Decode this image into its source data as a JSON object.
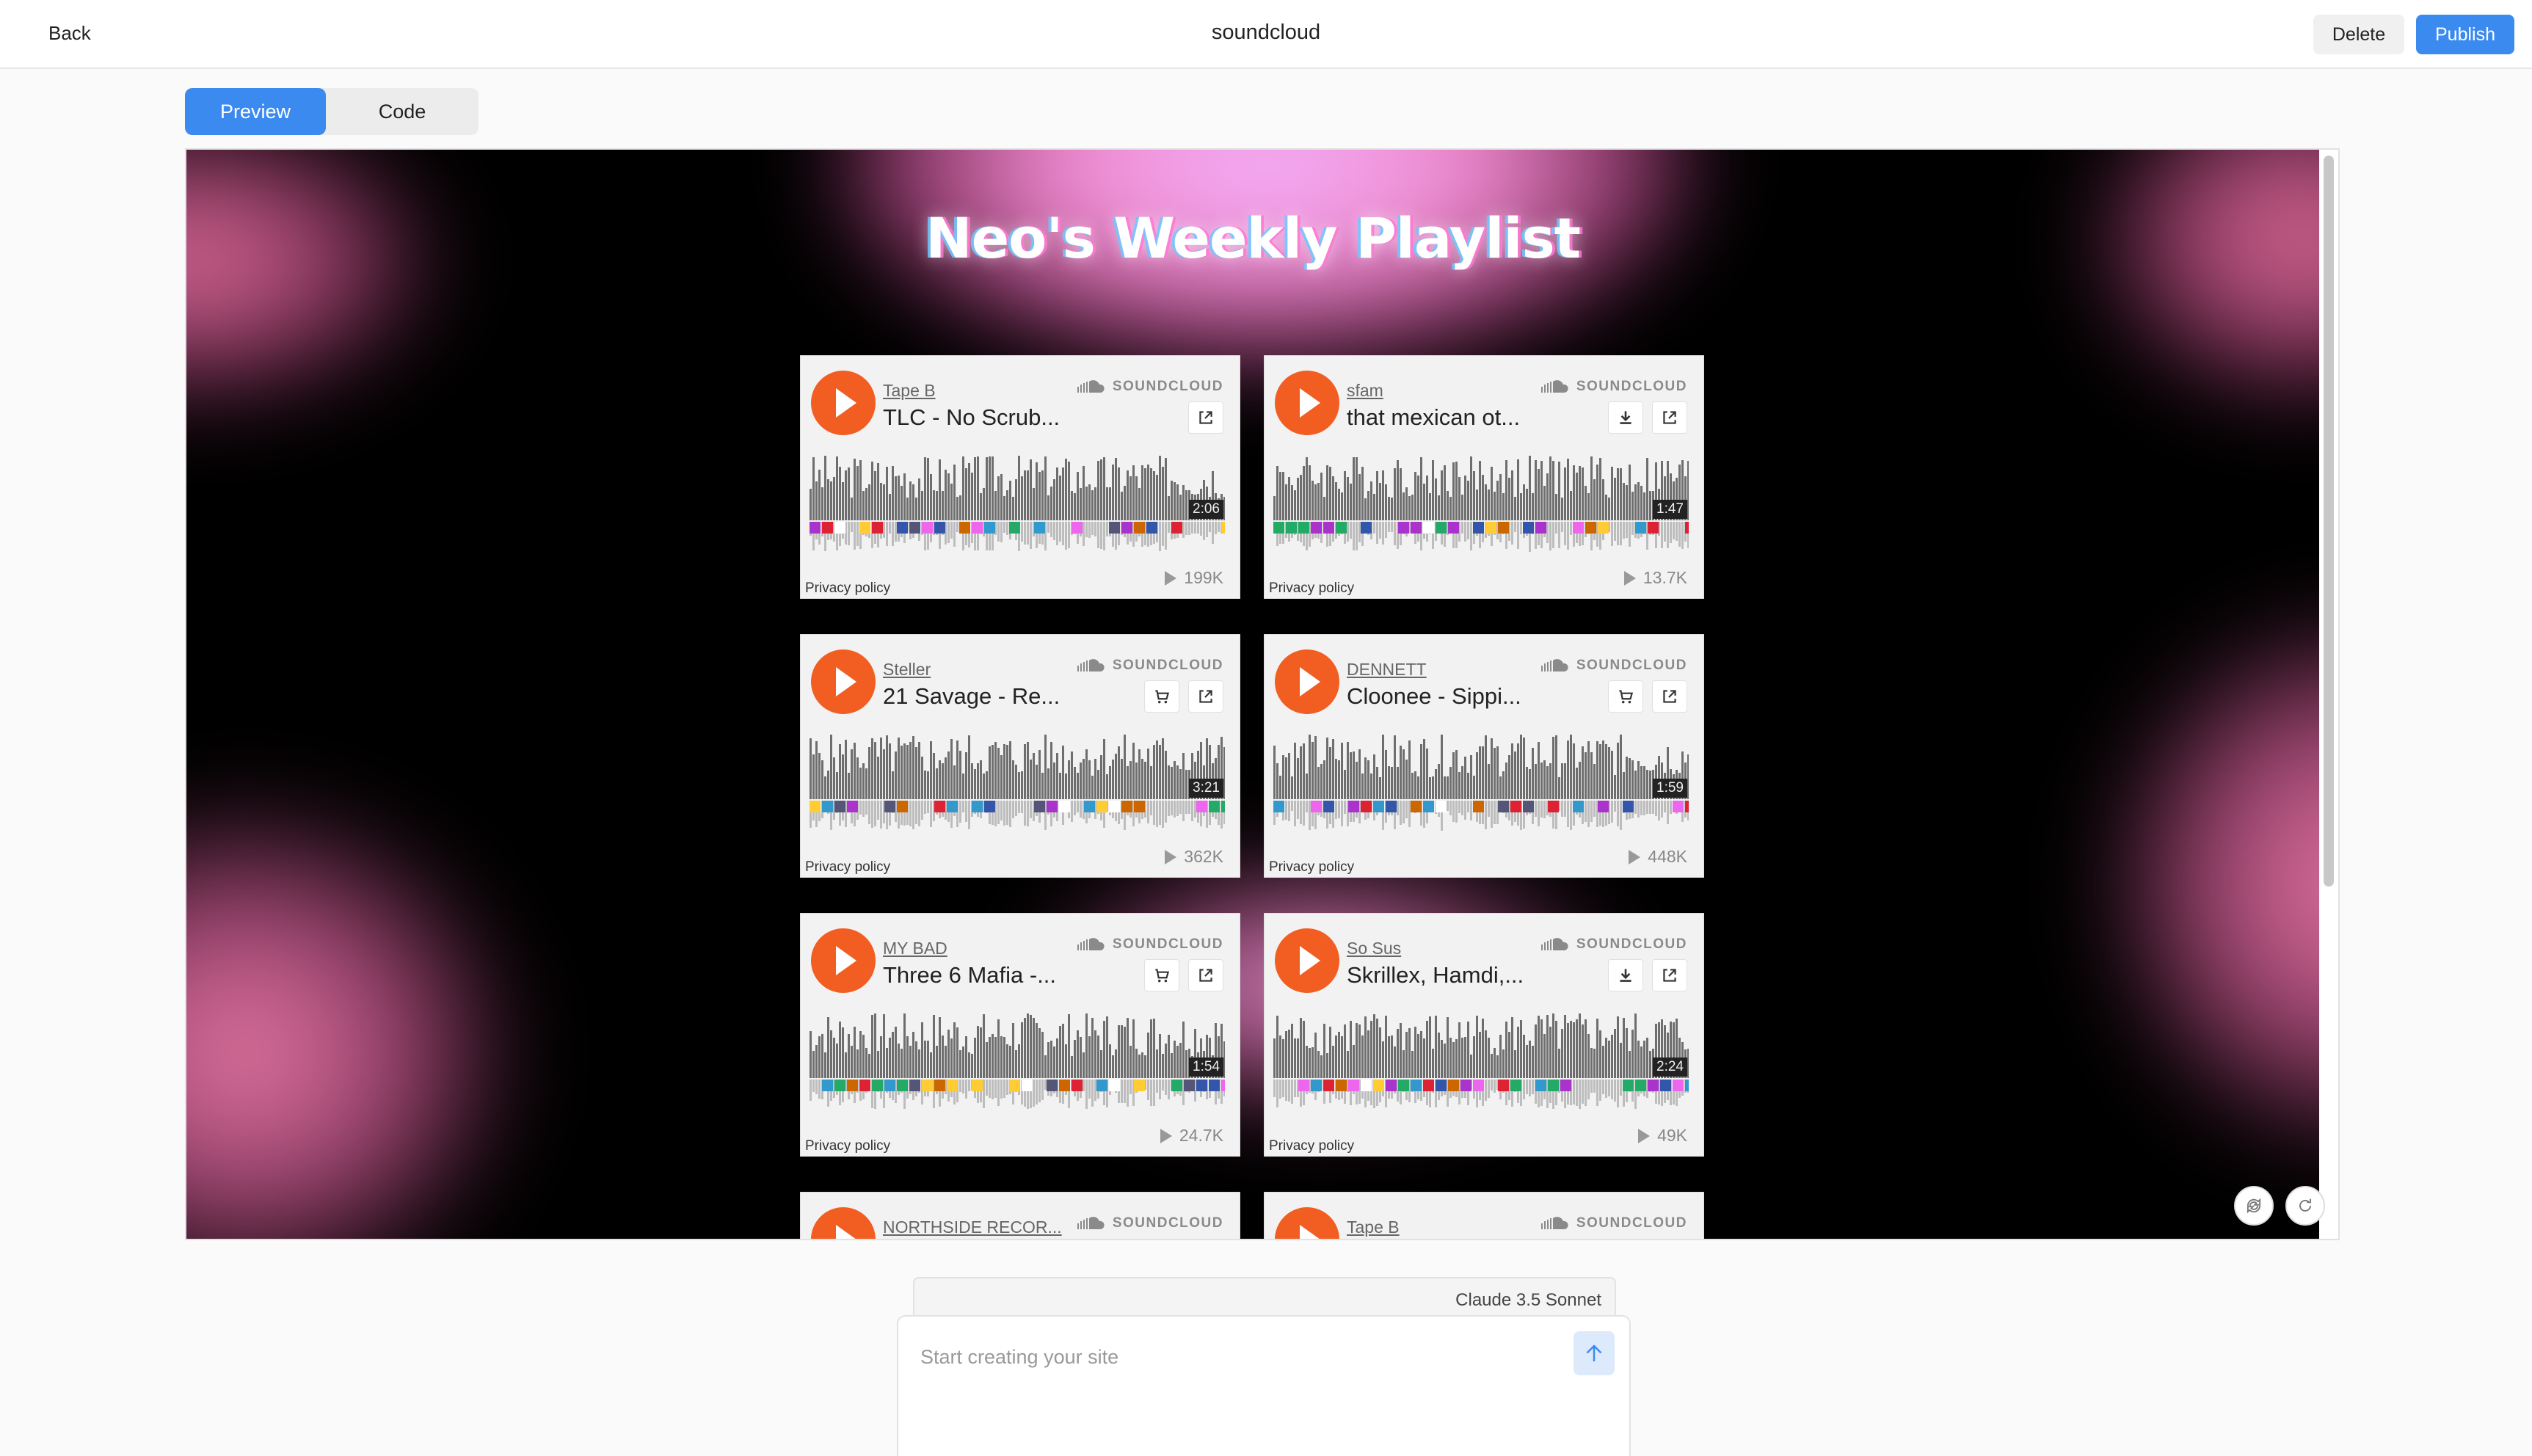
{
  "topbar": {
    "back_label": "Back",
    "title": "soundcloud",
    "delete_label": "Delete",
    "publish_label": "Publish"
  },
  "tabs": {
    "preview_label": "Preview",
    "code_label": "Code",
    "active": "Preview"
  },
  "preview": {
    "heading": "Neo's Weekly Playlist",
    "tracks": [
      {
        "artist": "Tape B",
        "title": "TLC - No Scrub...",
        "duration": "2:06",
        "plays": "199K",
        "actions": [
          "share"
        ]
      },
      {
        "artist": "sfam",
        "title": "that mexican ot...",
        "duration": "1:47",
        "plays": "13.7K",
        "actions": [
          "download",
          "share"
        ]
      },
      {
        "artist": "Steller",
        "title": "21 Savage - Re...",
        "duration": "3:21",
        "plays": "362K",
        "actions": [
          "buy",
          "share"
        ]
      },
      {
        "artist": "DENNETT",
        "title": "Cloonee - Sippi...",
        "duration": "1:59",
        "plays": "448K",
        "actions": [
          "buy",
          "share"
        ]
      },
      {
        "artist": "MY BAD",
        "title": "Three 6 Mafia -...",
        "duration": "1:54",
        "plays": "24.7K",
        "actions": [
          "buy",
          "share"
        ]
      },
      {
        "artist": "So Sus",
        "title": "Skrillex, Hamdi,...",
        "duration": "2:24",
        "plays": "49K",
        "actions": [
          "download",
          "share"
        ]
      },
      {
        "artist": "NORTHSIDE RECOR...",
        "title": "",
        "duration": "",
        "plays": "",
        "actions": []
      },
      {
        "artist": "Tape B",
        "title": "",
        "duration": "",
        "plays": "",
        "actions": []
      }
    ],
    "brand_text": "SOUNDCLOUD",
    "privacy_label": "Privacy policy",
    "colors": {
      "play": "#f25d22",
      "background": "#000000",
      "glow": "#f08ad0"
    }
  },
  "prompt": {
    "model": "Claude 3.5 Sonnet",
    "placeholder": "Start creating your site"
  },
  "icons": {
    "send": "arrow-up-icon",
    "share": "share-icon",
    "download": "download-icon",
    "buy": "cart-icon"
  }
}
